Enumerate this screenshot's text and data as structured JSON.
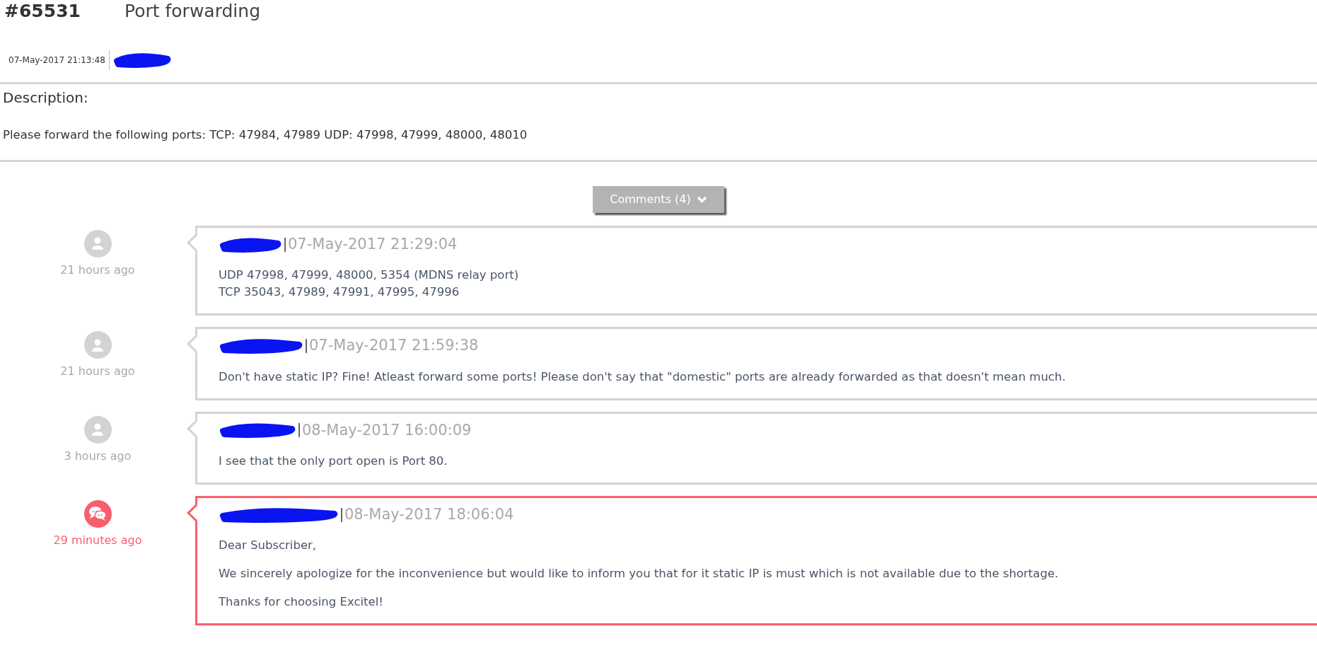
{
  "ticket": {
    "number": "#65531",
    "title": "Port forwarding",
    "created": "07-May-2017 21:13:48"
  },
  "description": {
    "label": "Description:",
    "text": "Please forward the following ports: TCP: 47984, 47989 UDP: 47998, 47999, 48000, 48010"
  },
  "comments_button": {
    "label": "Comments (4)"
  },
  "comments": [
    {
      "kind": "user",
      "time_ago": "21 hours ago",
      "date": "07-May-2017 21:29:04",
      "paragraphs": [
        "UDP 47998, 47999, 48000, 5354 (MDNS relay port)\nTCP 35043, 47989, 47991, 47995, 47996"
      ]
    },
    {
      "kind": "user",
      "time_ago": "21 hours ago",
      "date": "07-May-2017 21:59:38",
      "paragraphs": [
        "Don't have static IP? Fine! Atleast forward some ports! Please don't say that \"domestic\" ports are already forwarded as that doesn't mean much."
      ]
    },
    {
      "kind": "user",
      "time_ago": "3 hours ago",
      "date": "08-May-2017 16:00:09",
      "paragraphs": [
        "I see that the only port open is Port 80."
      ]
    },
    {
      "kind": "staff",
      "time_ago": "29 minutes ago",
      "date": "08-May-2017 18:06:04",
      "paragraphs": [
        "Dear Subscriber,",
        "We sincerely apologize for the inconvenience but would like to inform you that for it static IP is must which is not available due to the shortage.",
        "Thanks for choosing Excitel!"
      ]
    }
  ]
}
